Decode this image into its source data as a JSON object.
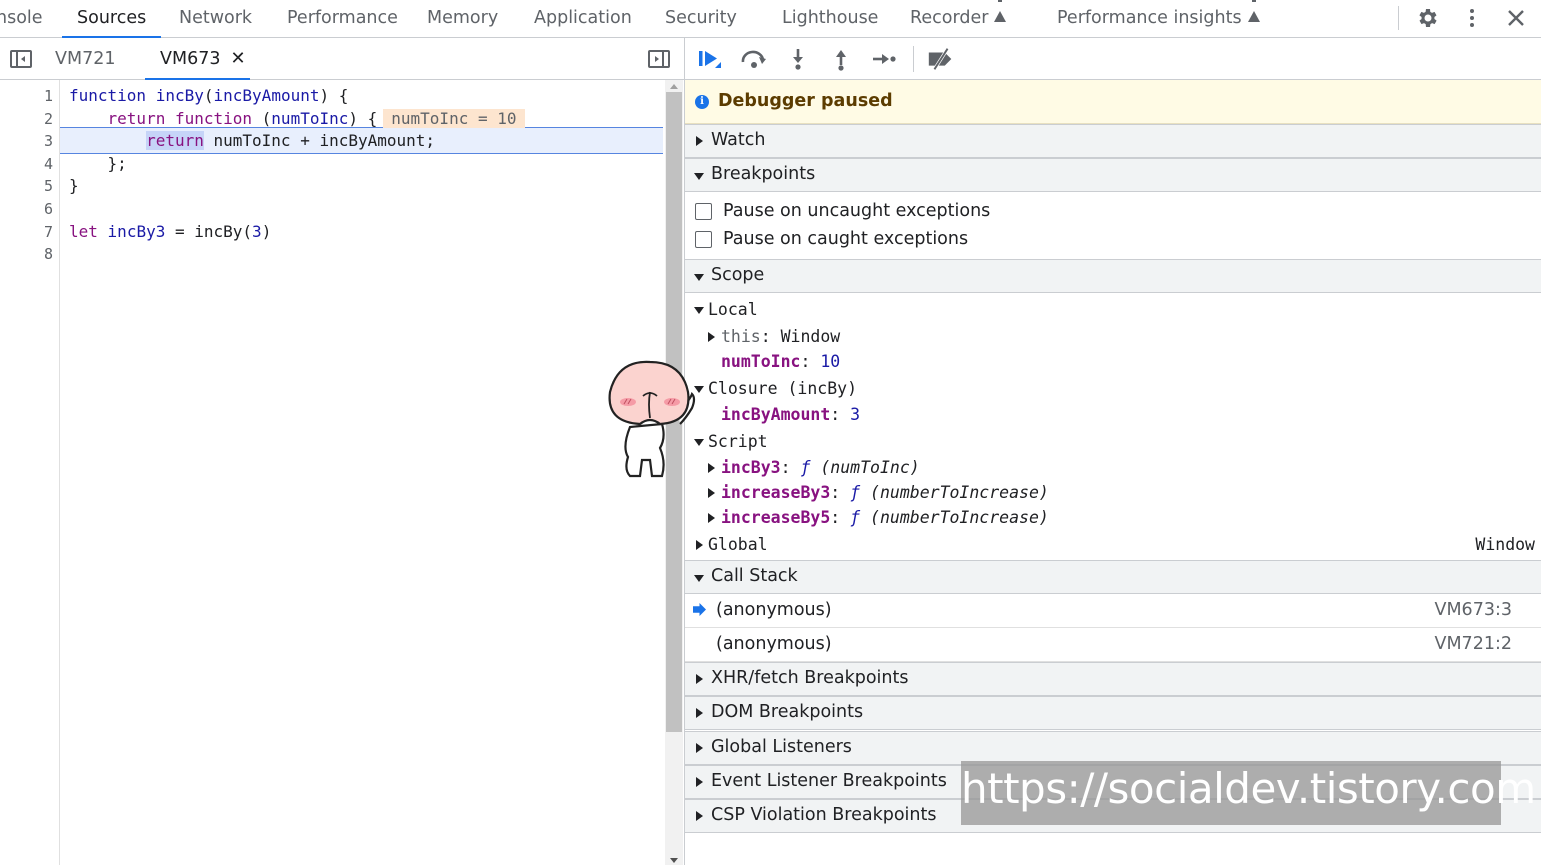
{
  "top_tabs": [
    "nsole",
    "Sources",
    "Network",
    "Performance",
    "Memory",
    "Application",
    "Security",
    "Lighthouse",
    "Recorder",
    "Performance insights"
  ],
  "top_icons": [
    "gear-icon",
    "kebab-menu-icon",
    "close-icon"
  ],
  "file_tabs": [
    {
      "label": "VM721",
      "active": false
    },
    {
      "label": "VM673",
      "active": true,
      "close": "✕"
    }
  ],
  "code": {
    "line_numbers": [
      "1",
      "2",
      "3",
      "4",
      "5",
      "6",
      "7",
      "8"
    ],
    "l1": {
      "kw": "function",
      "sp1": " ",
      "name": "incBy",
      "p1": "(",
      "param": "incByAmount",
      "p2": ") {"
    },
    "l2": {
      "indent": "    ",
      "kw1": "return",
      "sp1": " ",
      "kw2": "function",
      "sp2": " (",
      "param": "numToInc",
      "p2": ") {",
      "inline": "numToInc = 10"
    },
    "l3": {
      "indent": "        ",
      "kw": "return",
      "rest": " numToInc + incByAmount;"
    },
    "l4": {
      "text": "    };"
    },
    "l5": {
      "text": "}"
    },
    "l6": {
      "text": ""
    },
    "l7": {
      "kw": "let",
      "sp": " ",
      "var": "incBy3",
      "eq": " = incBy(",
      "num": "3",
      "end": ")"
    },
    "l8": {
      "text": ""
    }
  },
  "debugger": {
    "paused_text": "Debugger paused",
    "sections": {
      "watch": "Watch",
      "breakpoints": "Breakpoints",
      "scope": "Scope",
      "call_stack": "Call Stack",
      "xhr": "XHR/fetch Breakpoints",
      "dom": "DOM Breakpoints",
      "global_listeners": "Global Listeners",
      "event_listener": "Event Listener Breakpoints",
      "csp": "CSP Violation Breakpoints"
    },
    "pause_uncaught": "Pause on uncaught exceptions",
    "pause_caught": "Pause on caught exceptions",
    "scope": {
      "local": "Local",
      "this_key": "this",
      "this_val": "Window",
      "numToInc_key": "numToInc",
      "numToInc_val": "10",
      "closure": "Closure (incBy)",
      "incByAmount_key": "incByAmount",
      "incByAmount_val": "3",
      "script": "Script",
      "incBy3_key": "incBy3",
      "incBy3_sig": "(numToInc)",
      "increaseBy3_key": "increaseBy3",
      "increaseBy3_sig": "(numberToIncrease)",
      "increaseBy5_key": "increaseBy5",
      "increaseBy5_sig": "(numberToIncrease)",
      "f_glyph": "ƒ",
      "colon": ": ",
      "global": "Global",
      "global_val": "Window"
    },
    "call_stack": [
      {
        "name": "(anonymous)",
        "loc": "VM673:3",
        "current": true
      },
      {
        "name": "(anonymous)",
        "loc": "VM721:2",
        "current": false
      }
    ]
  },
  "watermark": "https://socialdev.tistory.com"
}
